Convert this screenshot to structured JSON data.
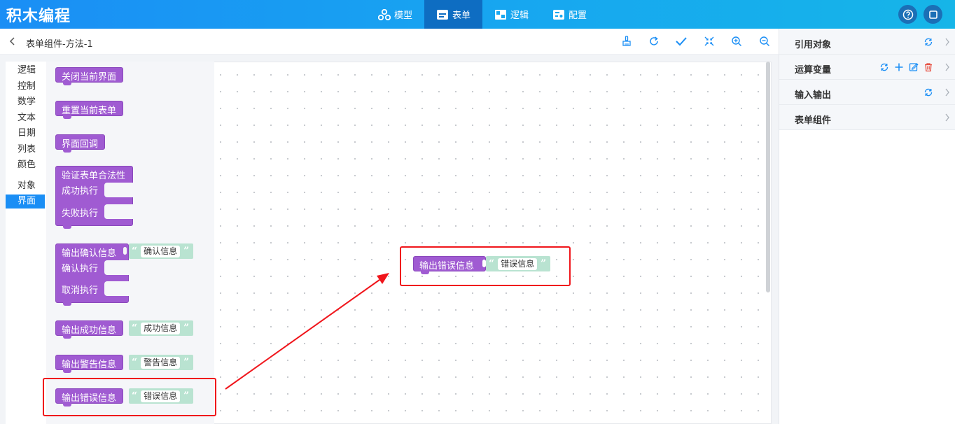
{
  "app": {
    "title": "积木编程"
  },
  "nav": [
    {
      "label": "模型",
      "icon": "model-icon",
      "active": false
    },
    {
      "label": "表单",
      "icon": "form-icon",
      "active": true
    },
    {
      "label": "逻辑",
      "icon": "logic-icon",
      "active": false
    },
    {
      "label": "配置",
      "icon": "config-icon",
      "active": false
    }
  ],
  "toolbar": {
    "title": "表单组件-方法-1"
  },
  "categories": [
    "逻辑",
    "控制",
    "数学",
    "文本",
    "日期",
    "列表",
    "颜色",
    "对象",
    "界面"
  ],
  "active_category": "界面",
  "blocks": {
    "close_screen": "关闭当前界面",
    "reset_form": "重置当前表单",
    "screen_callback": "界面回调",
    "validate_form": "验证表单合法性",
    "on_success": "成功执行",
    "on_fail": "失败执行",
    "confirm_msg": "输出确认信息",
    "confirm_text": "确认信息",
    "on_confirm": "确认执行",
    "on_cancel": "取消执行",
    "success_msg": "输出成功信息",
    "success_text": "成功信息",
    "warning_msg": "输出警告信息",
    "warning_text": "警告信息",
    "error_msg": "输出错误信息",
    "error_text": "错误信息"
  },
  "canvas_block": {
    "label": "输出错误信息",
    "text": "错误信息"
  },
  "right_panel": [
    {
      "label": "引用对象"
    },
    {
      "label": "运算变量"
    },
    {
      "label": "输入输出"
    },
    {
      "label": "表单组件"
    }
  ],
  "colors": {
    "header": "#1a8ef5",
    "block": "#a05bd2",
    "string": "#b9e3d1",
    "highlight": "#f0151b"
  }
}
